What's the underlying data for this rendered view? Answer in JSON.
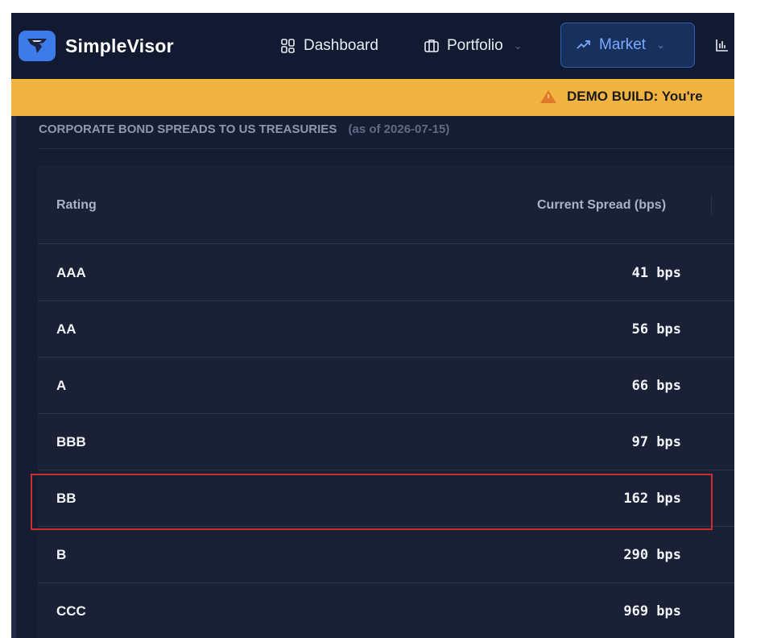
{
  "brand": {
    "name": "SimpleVisor",
    "logo_icon": "hawk-logo-icon",
    "logo_bg": "#3d7be8"
  },
  "nav": {
    "dashboard": {
      "label": "Dashboard",
      "icon": "grid-icon"
    },
    "portfolio": {
      "label": "Portfolio",
      "icon": "briefcase-icon"
    },
    "market": {
      "label": "Market",
      "icon": "trend-up-icon",
      "active": true
    },
    "more": {
      "icon": "bar-chart-icon"
    }
  },
  "banner": {
    "icon": "warning-icon",
    "text": "DEMO BUILD: You're",
    "bg": "#f2b440"
  },
  "section": {
    "title": "CORPORATE BOND SPREADS TO US TREASURIES",
    "date": "(as of 2026-07-15)"
  },
  "table": {
    "headers": {
      "rating": "Rating",
      "spread": "Current Spread (bps)"
    },
    "rows": [
      {
        "rating": "AAA",
        "spread": "41  bps"
      },
      {
        "rating": "AA",
        "spread": "56  bps"
      },
      {
        "rating": "A",
        "spread": "66  bps"
      },
      {
        "rating": "BBB",
        "spread": "97  bps"
      },
      {
        "rating": "BB",
        "spread": "162  bps",
        "highlighted": true
      },
      {
        "rating": "B",
        "spread": "290  bps"
      },
      {
        "rating": "CCC",
        "spread": "969  bps"
      }
    ]
  },
  "colors": {
    "accent": "#7aa9ff",
    "background": "#161d33",
    "highlight_border": "#cc2f2f"
  }
}
